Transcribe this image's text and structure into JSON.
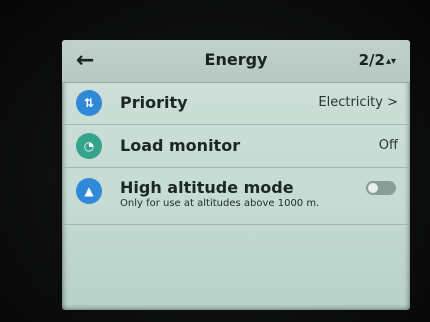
{
  "header": {
    "back_icon": "arrow-left-icon",
    "title": "Energy",
    "page": "2/2",
    "page_arrows": "▴▾"
  },
  "rows": [
    {
      "icon": "priority-icon",
      "icon_glyph": "⇅",
      "label": "Priority",
      "value": "Electricity >"
    },
    {
      "icon": "gauge-icon",
      "icon_glyph": "◔",
      "label": "Load monitor",
      "value": "Off"
    },
    {
      "icon": "mountain-icon",
      "icon_glyph": "▲",
      "label": "High altitude mode",
      "sublabel": "Only for use at altitudes above 1000 m.",
      "toggle_on": false
    }
  ],
  "colors": {
    "icon_blue": "#2f88d8",
    "icon_teal": "#35a48d",
    "screen_bg": "#c5dbd3"
  }
}
